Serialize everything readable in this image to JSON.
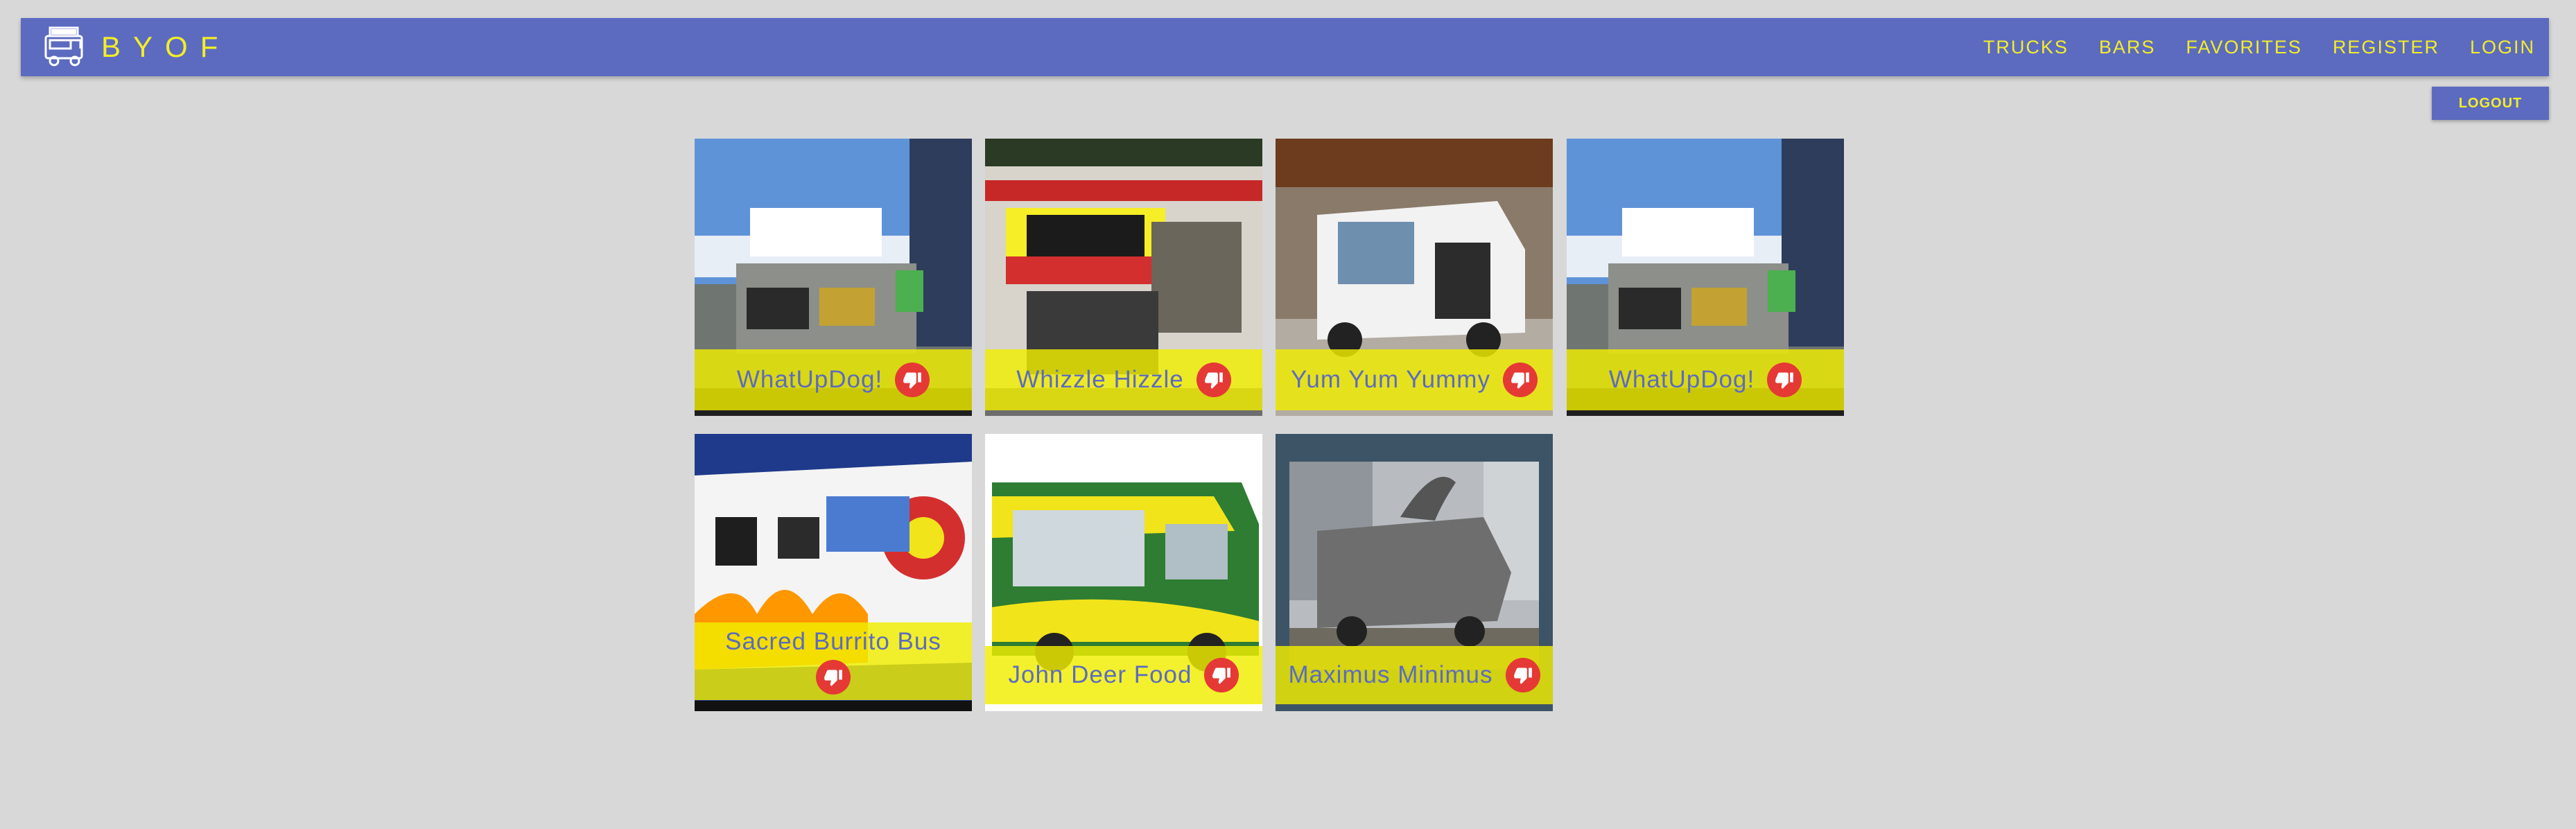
{
  "header": {
    "brand": "BYOF",
    "nav": [
      "TRUCKS",
      "BARS",
      "FAVORITES",
      "REGISTER",
      "LOGIN"
    ]
  },
  "logout_label": "LOGOUT",
  "colors": {
    "navbar": "#5c6bc0",
    "accent_yellow": "#f3ee28",
    "dislike_red": "#e53935",
    "background": "#d8d8d8"
  },
  "trucks": [
    {
      "name": "WhatUpDog!"
    },
    {
      "name": "Whizzle Hizzle"
    },
    {
      "name": "Yum Yum Yummy"
    },
    {
      "name": "WhatUpDog!"
    },
    {
      "name": "Sacred Burrito Bus"
    },
    {
      "name": "John Deer Food"
    },
    {
      "name": "Maximus Minimus"
    }
  ],
  "icons": {
    "logo": "food-truck-icon",
    "dislike": "thumbs-down-icon"
  }
}
